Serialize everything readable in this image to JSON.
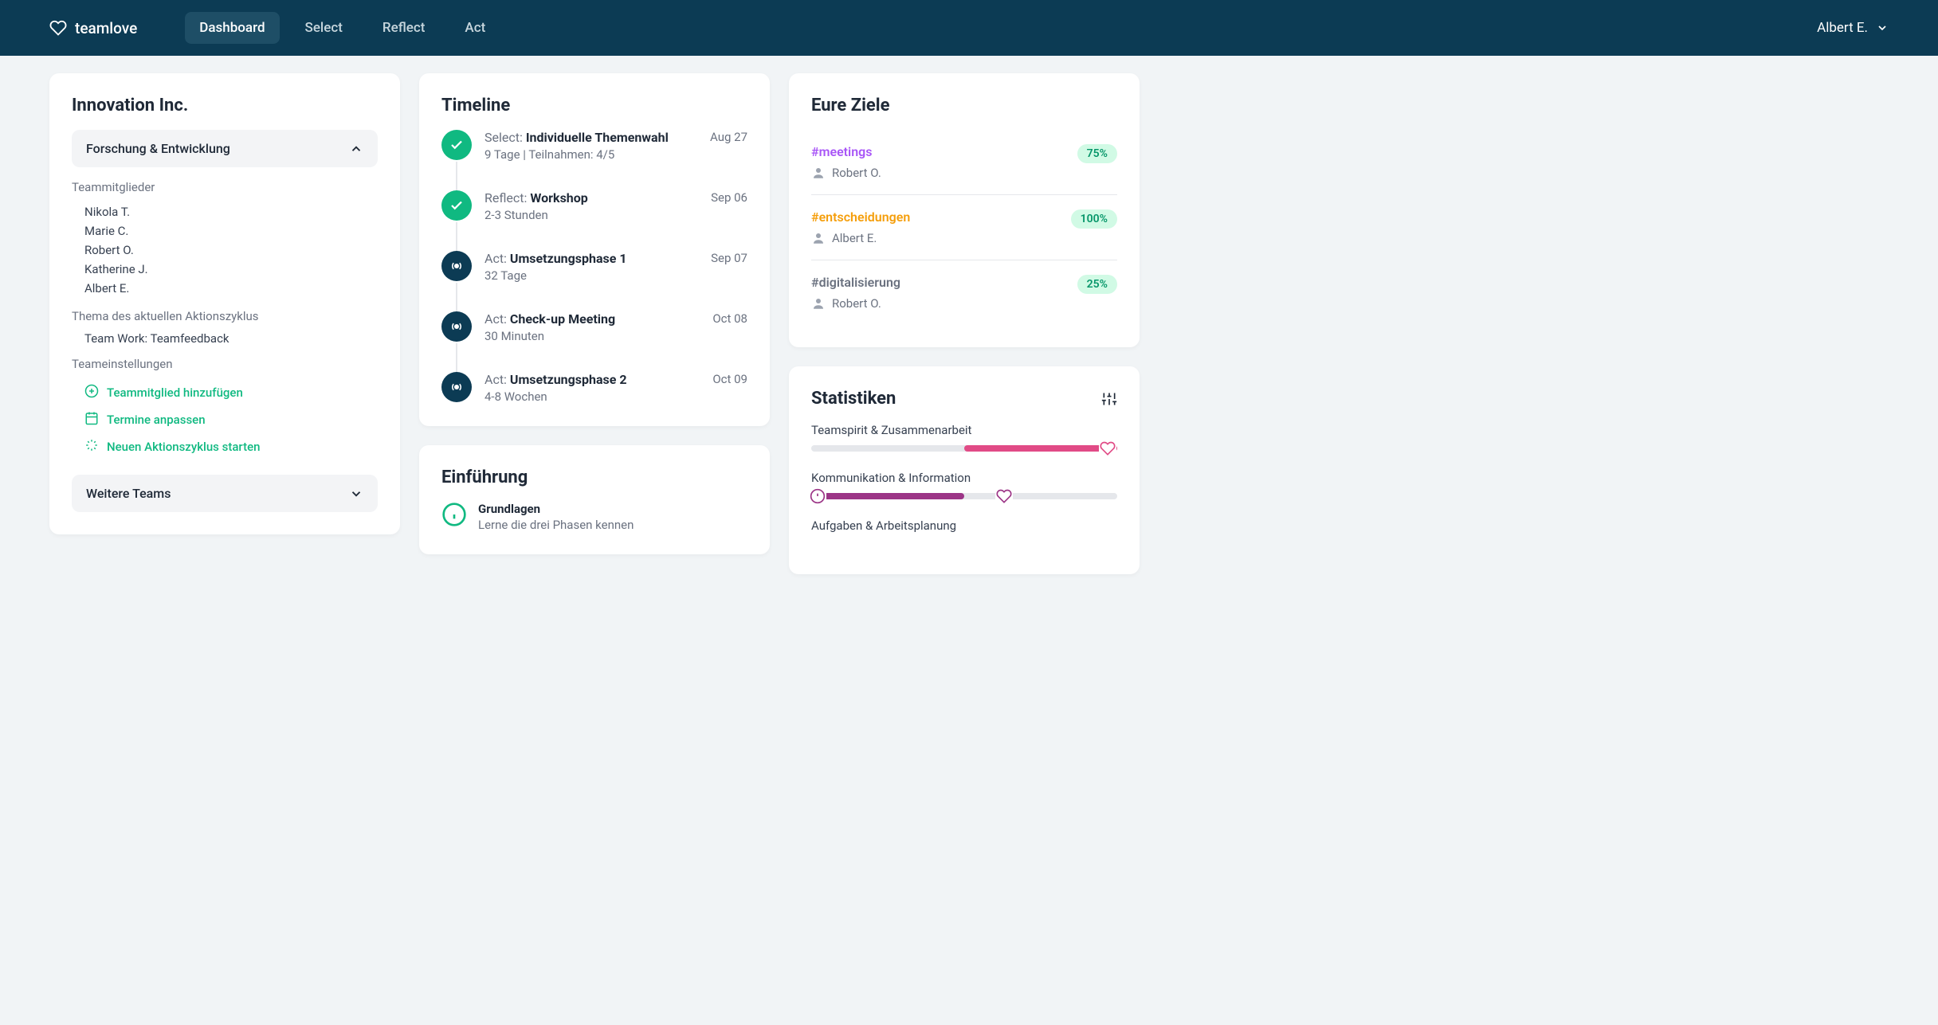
{
  "brand": "teamlove",
  "nav": {
    "items": [
      {
        "label": "Dashboard",
        "active": true
      },
      {
        "label": "Select",
        "active": false
      },
      {
        "label": "Reflect",
        "active": false
      },
      {
        "label": "Act",
        "active": false
      }
    ]
  },
  "user": {
    "name": "Albert E."
  },
  "sidebar": {
    "company": "Innovation Inc.",
    "team_expanded": "Forschung & Entwicklung",
    "members_label": "Teammitglieder",
    "members": [
      "Nikola T.",
      "Marie C.",
      "Robert O.",
      "Katherine J.",
      "Albert E."
    ],
    "topic_label": "Thema des aktuellen Aktionszyklus",
    "topic": "Team Work: Teamfeedback",
    "settings_label": "Teameinstellungen",
    "settings": [
      {
        "icon": "plus-circle",
        "label": "Teammitglied hinzufügen"
      },
      {
        "icon": "calendar",
        "label": "Termine anpassen"
      },
      {
        "icon": "sparkle",
        "label": "Neuen Aktionszyklus starten"
      }
    ],
    "other_teams": "Weitere Teams"
  },
  "timeline": {
    "title": "Timeline",
    "items": [
      {
        "status": "done",
        "phase": "Select:",
        "name": "Individuelle Themenwahl",
        "sub": "9 Tage | Teilnahmen: 4/5",
        "date": "Aug 27"
      },
      {
        "status": "done",
        "phase": "Reflect:",
        "name": "Workshop",
        "sub": "2-3 Stunden",
        "date": "Sep 06"
      },
      {
        "status": "pending",
        "phase": "Act:",
        "name": "Umsetzungsphase 1",
        "sub": "32 Tage",
        "date": "Sep 07"
      },
      {
        "status": "pending",
        "phase": "Act:",
        "name": "Check-up Meeting",
        "sub": "30 Minuten",
        "date": "Oct 08"
      },
      {
        "status": "pending",
        "phase": "Act:",
        "name": "Umsetzungsphase 2",
        "sub": "4-8 Wochen",
        "date": "Oct 09"
      }
    ]
  },
  "intro": {
    "title": "Einführung",
    "items": [
      {
        "title": "Grundlagen",
        "sub": "Lerne die drei Phasen kennen"
      }
    ]
  },
  "goals": {
    "title": "Eure Ziele",
    "items": [
      {
        "tag": "#meetings",
        "color": "purple",
        "user": "Robert O.",
        "pct": "75%"
      },
      {
        "tag": "#entscheidungen",
        "color": "orange",
        "user": "Albert E.",
        "pct": "100%"
      },
      {
        "tag": "#digitalisierung",
        "color": "gray",
        "user": "Robert O.",
        "pct": "25%"
      }
    ]
  },
  "stats": {
    "title": "Statistiken",
    "rows": [
      {
        "label": "Teamspirit & Zusammenarbeit",
        "color": "#e14b86",
        "start": 50,
        "end": 100,
        "marker": 97,
        "marker_icon": "heart"
      },
      {
        "label": "Kommunikation & Information",
        "color": "#9c3587",
        "start": 2,
        "end": 50,
        "marker": 63,
        "marker_icon": "heart",
        "warn": 2
      },
      {
        "label": "Aufgaben & Arbeitsplanung",
        "color": "",
        "start": 0,
        "end": 0
      }
    ]
  }
}
